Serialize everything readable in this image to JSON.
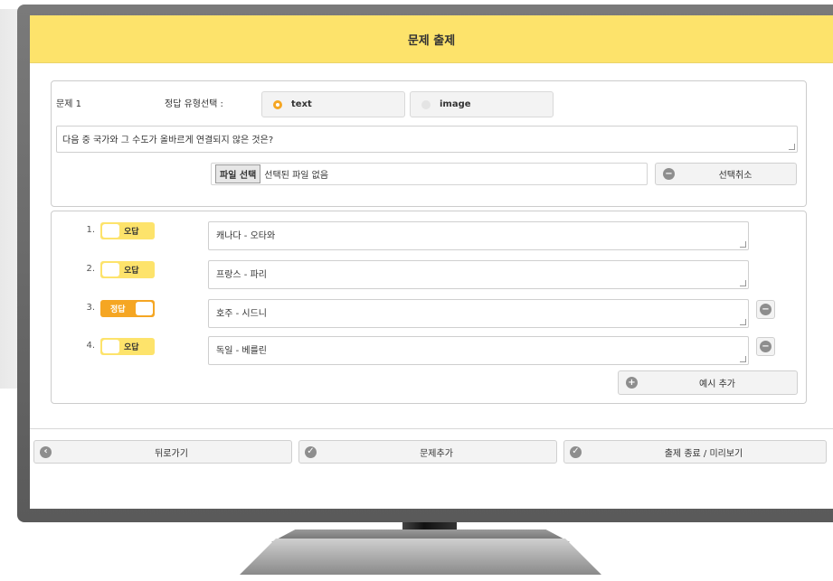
{
  "header": {
    "title": "문제 출제"
  },
  "question": {
    "label": "문제 1",
    "answer_type_label": "정답 유형선택 :",
    "type_options": [
      {
        "label": "text",
        "selected": true
      },
      {
        "label": "image",
        "selected": false
      }
    ],
    "text": "다음 중 국가와 그 수도가 올바르게 연결되지 않은 것은?",
    "file_button": "파일 선택",
    "file_status": "선택된 파일 없음",
    "cancel_selection": "선택취소"
  },
  "options": [
    {
      "number": "1.",
      "toggle": "오답",
      "correct": false,
      "text": "캐나다 - 오타와",
      "removable": false
    },
    {
      "number": "2.",
      "toggle": "오답",
      "correct": false,
      "text": "프랑스 - 파리",
      "removable": false
    },
    {
      "number": "3.",
      "toggle": "정답",
      "correct": true,
      "text": "호주 - 시드니",
      "removable": true
    },
    {
      "number": "4.",
      "toggle": "오답",
      "correct": false,
      "text": "독일 - 베를린",
      "removable": true
    }
  ],
  "add_example": "예시 추가",
  "footer": {
    "back": "뒤로가기",
    "add_question": "문제추가",
    "finish_preview": "출제 종료 / 미리보기"
  },
  "colors": {
    "header": "#fde36b",
    "accent": "#f5a623",
    "icon": "#8e8e8e"
  }
}
